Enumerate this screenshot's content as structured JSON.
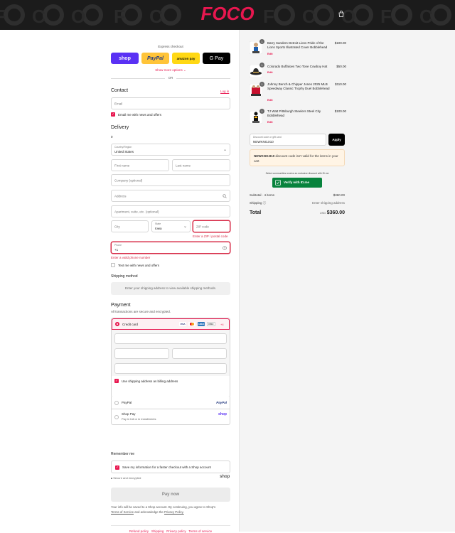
{
  "header": {
    "brand": "FOCO",
    "cart_icon": "shopping-bag-icon",
    "brand_color": "#e8174f"
  },
  "express": {
    "title": "Express checkout",
    "buttons": [
      {
        "label": "shop",
        "color": "#5a31f4"
      },
      {
        "label": "PayPal",
        "color": "#ffc439"
      },
      {
        "label": "amazon pay",
        "color": "#ffd814"
      },
      {
        "label": "G Pay",
        "color": "#000000"
      }
    ],
    "more": "Show more options",
    "or": "OR"
  },
  "contact": {
    "title": "Contact",
    "login": "Log in",
    "email_placeholder": "Email",
    "news_label": "Email me with news and offers"
  },
  "delivery": {
    "title": "Delivery",
    "country_label": "Country/Region",
    "country_value": "United States",
    "first_name": "First name",
    "last_name": "Last name",
    "company": "Company (optional)",
    "address": "Address",
    "apartment": "Apartment, suite, etc. (optional)",
    "city": "City",
    "state_label": "State",
    "state_value": "Iowa",
    "zip": "ZIP code",
    "zip_error": "Enter a ZIP / postal code",
    "phone_label": "Phone",
    "phone_value": "+1",
    "phone_error": "Enter a valid phone number",
    "text_label": "Text me with news and offers"
  },
  "shipping": {
    "title": "Shipping method",
    "message": "Enter your shipping address to view available shipping methods."
  },
  "payment": {
    "title": "Payment",
    "subtitle": "All transactions are secure and encrypted.",
    "credit": "Credit card",
    "cards": [
      "VISA",
      "MC",
      "AMEX",
      "DISC"
    ],
    "more_cards": "+4",
    "billing_label": "Use shipping address as billing address",
    "paypal": "PayPal",
    "shoppay": "Shop Pay",
    "shoppay_sub": "Pay in full or in installments",
    "shoppay_logo": "shop",
    "paypal_logo": "PayPal"
  },
  "remember": {
    "title": "Remember me",
    "save_label": "Save my information for a faster checkout with a Shop account",
    "secure": "Secure and encrypted",
    "shop_logo": "shop"
  },
  "pay_now": "Pay now",
  "legal": {
    "text1": "Your info will be saved to a Shop account. By continuing, you agree to Shop's",
    "terms": "Terms of Service",
    "text2": "and acknowledge the",
    "privacy": "Privacy Policy."
  },
  "footer": [
    "Refund policy",
    "Shipping",
    "Privacy policy",
    "Terms of service"
  ],
  "cart": {
    "items": [
      {
        "qty": "1",
        "name": "Barry Sanders Detroit Lions Pride of the Lions Sports Illustrated Cover Bobblehead",
        "price": "$100.00",
        "edit": "Edit"
      },
      {
        "qty": "1",
        "name": "Colorado Buffaloes Two Tone Cowboy Hat",
        "price": "$50.00",
        "edit": "Edit"
      },
      {
        "qty": "1",
        "name": "Johnny Bench & Chipper Jones 2025 MLB Speedway Classic Trophy Duel Bobblehead",
        "price": "$110.00",
        "edit": "Edit"
      },
      {
        "qty": "1",
        "name": "TJ Watt Pittsburgh Steelers Steel City Bobblehead",
        "price": "$100.00",
        "edit": "Edit"
      }
    ],
    "discount_label": "Discount code or gift card",
    "discount_value": "NEWKNOJI10",
    "apply": "Apply",
    "warning_code": "NEWKNOJI10",
    "warning_text": "discount code isn't valid for the items in your cart",
    "idme_note": "Select communities receive an exclusive discount with ID.me",
    "idme_button": "Verify with ID.me",
    "subtotal_label": "Subtotal · 4 items",
    "subtotal_value": "$360.00",
    "shipping_label": "Shipping",
    "shipping_value": "Enter shipping address",
    "total_label": "Total",
    "currency": "USD",
    "total_value": "$360.00"
  }
}
